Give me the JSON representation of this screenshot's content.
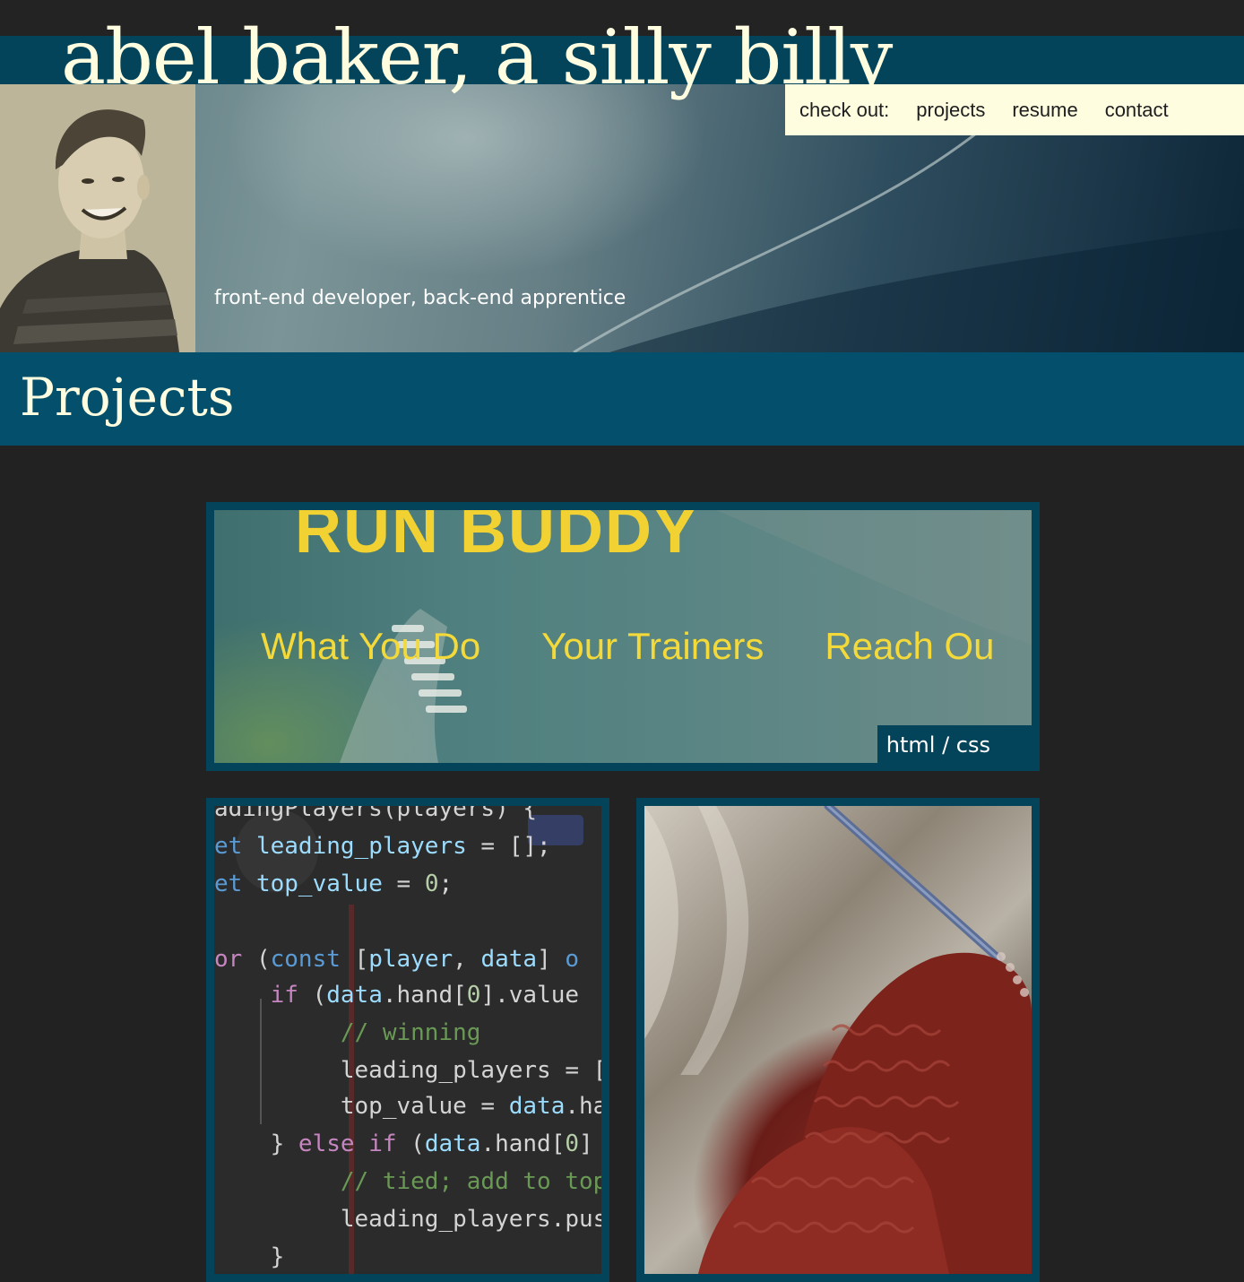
{
  "header": {
    "site_title": "abel baker, a silly billy",
    "tagline": "front-end developer, back-end apprentice"
  },
  "nav": {
    "prefix": "check out:",
    "links": [
      "projects",
      "resume",
      "contact"
    ]
  },
  "projects": {
    "heading": "Projects",
    "featured": {
      "screenshot_title": "RUN BUDDY",
      "screenshot_nav": [
        "What You Do",
        "Your Trainers",
        "Reach Ou"
      ],
      "tech": "html / css"
    },
    "code_card": {
      "lines": [
        "adingPlayers(players) {",
        "et leading_players = [];",
        "et top_value = 0;",
        "",
        "or (const [player, data] o",
        "   if (data.hand[0].value",
        "       // winning",
        "       leading_players = [",
        "       top_value = data.ha",
        "   } else if (data.hand[0]",
        "       // tied; add to top",
        "       leading_players.pus",
        "   }"
      ]
    },
    "knit_card": {}
  },
  "colors": {
    "background": "#222222",
    "header_band": "#04445a",
    "projects_band": "#04506c",
    "cream": "#fffde0",
    "runbuddy_yellow": "#f1d232"
  }
}
